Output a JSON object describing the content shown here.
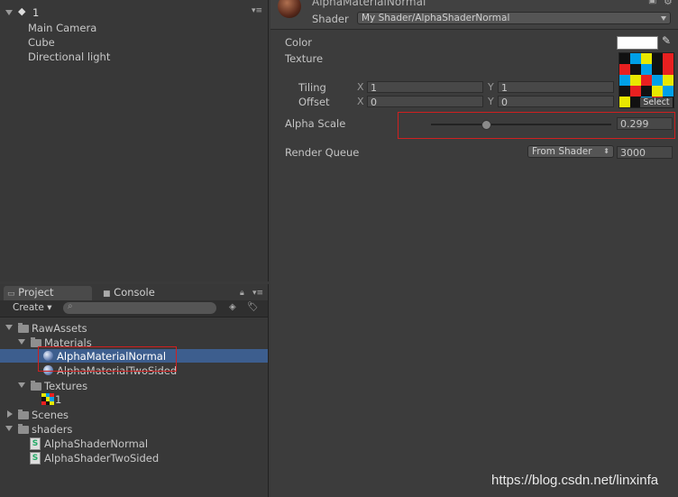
{
  "hierarchy": {
    "scene_name": "1",
    "items": [
      "Main Camera",
      "Cube",
      "Directional light"
    ]
  },
  "project": {
    "tabs": [
      {
        "label": "Project"
      },
      {
        "label": "Console"
      }
    ],
    "create_label": "Create",
    "search_placeholder": "",
    "tree": [
      {
        "label": "RawAssets",
        "kind": "folder",
        "depth": 0,
        "expanded": true
      },
      {
        "label": "Materials",
        "kind": "folder",
        "depth": 1,
        "expanded": true
      },
      {
        "label": "AlphaMaterialNormal",
        "kind": "material",
        "depth": 2,
        "selected": true
      },
      {
        "label": "AlphaMaterialTwoSided",
        "kind": "material",
        "depth": 2
      },
      {
        "label": "Textures",
        "kind": "folder",
        "depth": 1,
        "expanded": true
      },
      {
        "label": "1",
        "kind": "texture",
        "depth": 2
      },
      {
        "label": "Scenes",
        "kind": "folder",
        "depth": 0,
        "expanded": false
      },
      {
        "label": "shaders",
        "kind": "folder",
        "depth": 0,
        "expanded": true
      },
      {
        "label": "AlphaShaderNormal",
        "kind": "shader",
        "depth": 1
      },
      {
        "label": "AlphaShaderTwoSided",
        "kind": "shader",
        "depth": 1
      }
    ]
  },
  "inspector": {
    "material_name": "AlphaMaterialNormal",
    "shader_label": "Shader",
    "shader_value": "My Shader/AlphaShaderNormal",
    "color_label": "Color",
    "color_value": "#ffffff",
    "texture_label": "Texture",
    "tiling_label": "Tiling",
    "offset_label": "Offset",
    "x_label": "X",
    "y_label": "Y",
    "tiling_x": "1",
    "tiling_y": "1",
    "offset_x": "0",
    "offset_y": "0",
    "select_label": "Select",
    "alpha_label": "Alpha Scale",
    "alpha_value": "0.299",
    "alpha_fraction": 0.299,
    "render_queue_label": "Render Queue",
    "render_queue_mode": "From Shader",
    "render_queue_value": "3000"
  },
  "texture_colors": [
    "#111111",
    "#00a0e8",
    "#e8e800",
    "#111111",
    "#e82020",
    "#e82020",
    "#111111",
    "#00a0e8",
    "#111111",
    "#e82020",
    "#00a0e8",
    "#e8e800",
    "#e82020",
    "#00a0e8",
    "#e8e800",
    "#111111",
    "#e82020",
    "#111111",
    "#e8e800",
    "#00a0e8",
    "#e8e800",
    "#111111",
    "#00a0e8",
    "#e82020",
    "#111111"
  ],
  "colors": {
    "selection": "#3d5e8e",
    "highlight_box": "#d02020"
  },
  "watermark": "https://blog.csdn.net/linxinfa"
}
